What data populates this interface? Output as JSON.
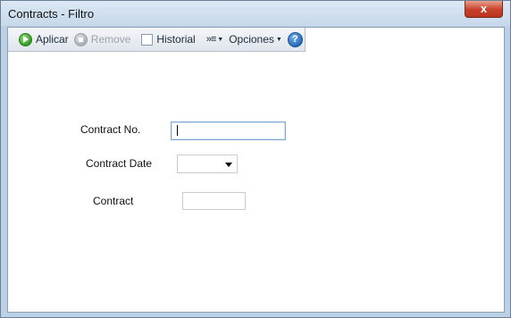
{
  "window": {
    "title": "Contracts - Filtro",
    "close_label": "x"
  },
  "toolbar": {
    "apply_label": "Aplicar",
    "remove_label": "Remove",
    "history_label": "Historial",
    "more_icon": "»≡",
    "options_label": "Opciones",
    "help_glyph": "?"
  },
  "form": {
    "contract_no_label": "Contract No.",
    "contract_no_value": "",
    "contract_date_label": "Contract Date",
    "contract_date_value": "",
    "contract_label": "Contract",
    "contract_value": ""
  },
  "colors": {
    "title_bar": "#c6d8ea",
    "close_button": "#c8402a",
    "apply_icon": "#2f9a1d",
    "help_icon": "#2468b6"
  }
}
